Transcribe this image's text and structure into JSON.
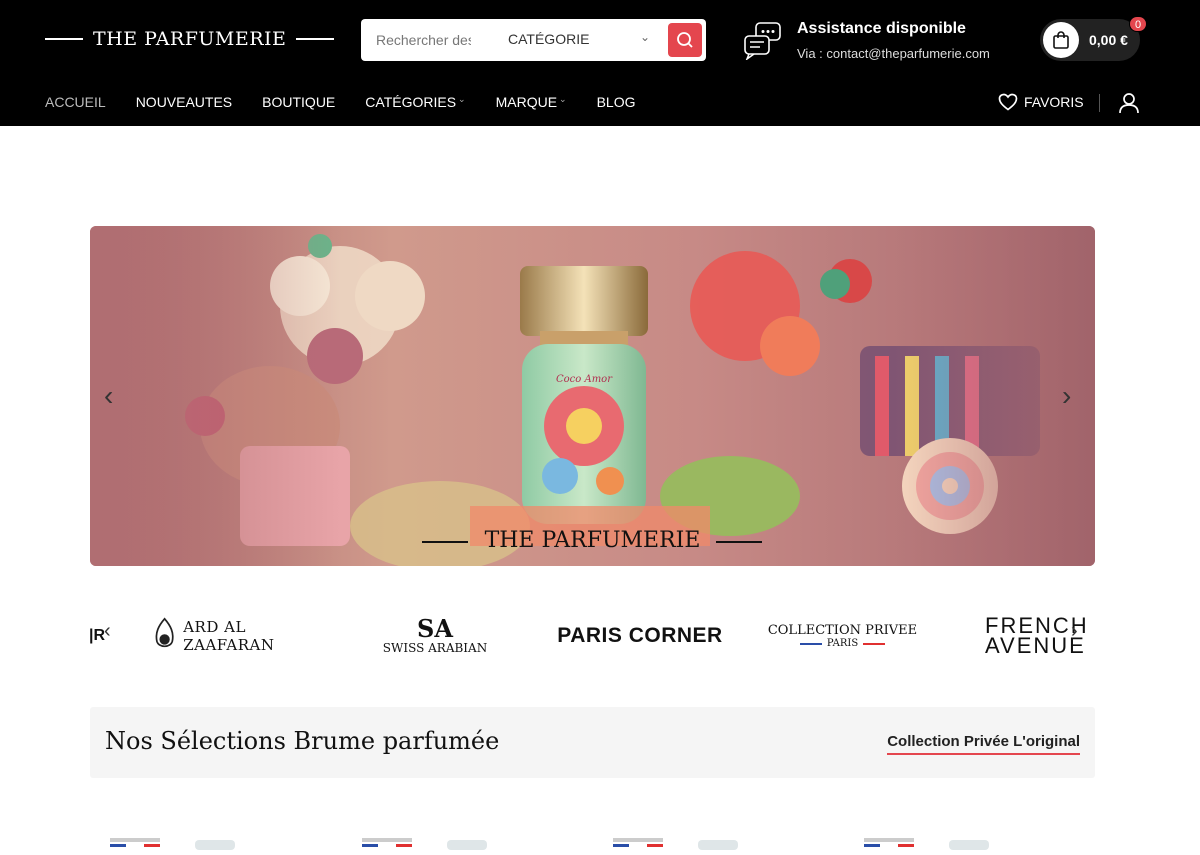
{
  "header": {
    "logo": "THE PARFUMERIE",
    "search": {
      "placeholder": "Rechercher des produits",
      "category": "CATÉGORIE"
    },
    "assist": {
      "title": "Assistance disponible",
      "sub": "Via : contact@theparfumerie.com"
    },
    "cart": {
      "amount": "0,00 €",
      "count": "0"
    },
    "nav": [
      {
        "label": "ACCUEIL"
      },
      {
        "label": "NOUVEAUTES"
      },
      {
        "label": "BOUTIQUE"
      },
      {
        "label": "CATÉGORIES"
      },
      {
        "label": "MARQUE"
      },
      {
        "label": "BLOG"
      }
    ],
    "favorites": "FAVORIS"
  },
  "hero": {
    "brand": "THE PARFUMERIE",
    "bottle_label": "Coco Amor"
  },
  "brands": [
    {
      "name": "ARD AL ZAAFARAN"
    },
    {
      "name": "SWISS ARABIAN"
    },
    {
      "name": "PARIS CORNER"
    },
    {
      "name": "COLLECTION PRIVEE",
      "sub": "PARIS"
    },
    {
      "name": "FRENCH",
      "sub": "AVENUE"
    }
  ],
  "section": {
    "title": "Nos Sélections Brume parfumée",
    "link": "Collection Privée L'original"
  },
  "colors": {
    "accent": "#e4464e",
    "header_bg": "#000000"
  }
}
